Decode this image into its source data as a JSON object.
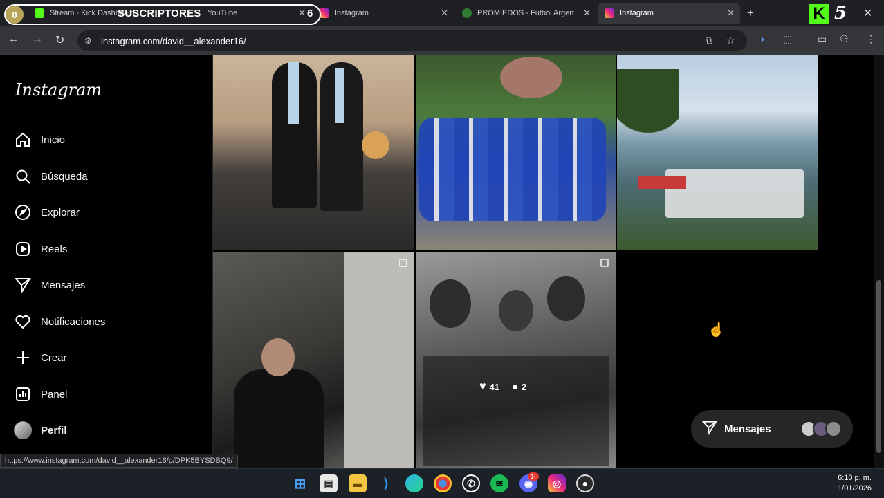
{
  "browser": {
    "tabs": [
      {
        "label": "Stream - Kick Dashboard",
        "favicon_color": "#53fc18"
      },
      {
        "label": "YouTube",
        "favicon_color": "#ff0000"
      },
      {
        "label": "Instagram",
        "favicon_color": "#e1306c"
      },
      {
        "label": "PROMIEDOS - Futbol Argentino",
        "favicon_color": "#2e7d32"
      },
      {
        "label": "Instagram",
        "favicon_color": "#e1306c"
      }
    ],
    "url": "instagram.com/david__alexander16/",
    "status_url": "https://www.instagram.com/david__alexander16/p/DPK5BYSDBQ9/"
  },
  "overlay": {
    "subs_left": "0",
    "subs_label": "SUSCRIPTORES",
    "subs_right": "6",
    "kick_logo": "K",
    "kick_count": "5"
  },
  "sidebar": {
    "logo": "Instagram",
    "items": [
      {
        "label": "Inicio",
        "icon": "home-icon"
      },
      {
        "label": "Búsqueda",
        "icon": "search-icon"
      },
      {
        "label": "Explorar",
        "icon": "compass-icon"
      },
      {
        "label": "Reels",
        "icon": "reels-icon"
      },
      {
        "label": "Mensajes",
        "icon": "send-icon"
      },
      {
        "label": "Notificaciones",
        "icon": "heart-icon"
      },
      {
        "label": "Crear",
        "icon": "plus-icon"
      },
      {
        "label": "Panel",
        "icon": "chart-icon"
      },
      {
        "label": "Perfil",
        "icon": "avatar"
      }
    ]
  },
  "posts": [
    {
      "description": "graduation-photo"
    },
    {
      "description": "group-photo-arvi"
    },
    {
      "description": "lake-boats"
    },
    {
      "description": "mirror-selfie"
    },
    {
      "description": "black-and-white-family",
      "likes": "41",
      "comments": "2"
    }
  ],
  "messages_pill": {
    "label": "Mensajes"
  },
  "taskbar": {
    "apps": [
      "windows-start",
      "store",
      "file-explorer",
      "vscode",
      "edge",
      "chrome",
      "whatsapp",
      "spotify",
      "discord",
      "instagram",
      "obs"
    ],
    "discord_badge": "9+",
    "time": "6:10 p. m.",
    "date": "1/01/2026"
  }
}
